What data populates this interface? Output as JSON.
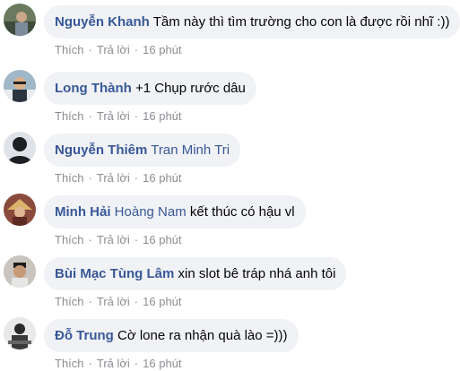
{
  "comments": [
    {
      "author": "Nguyễn Khanh",
      "tag": "",
      "text": "Tầm này thì tìm trường cho con là được rồi nhĩ :))",
      "like": "Thích",
      "reply": "Trả lời",
      "time": "16 phút"
    },
    {
      "author": "Long Thành",
      "tag": "",
      "text": "+1 Chụp rước dâu",
      "like": "Thích",
      "reply": "Trả lời",
      "time": "16 phút"
    },
    {
      "author": "Nguyễn Thiêm",
      "tag": "Tran Minh Tri",
      "text": "",
      "like": "Thích",
      "reply": "Trả lời",
      "time": "16 phút"
    },
    {
      "author": "Minh Hải",
      "tag": "Hoàng Nam",
      "text": "kết thúc có hậu vl",
      "like": "Thích",
      "reply": "Trả lời",
      "time": "16 phút"
    },
    {
      "author": "Bùi Mạc Tùng Lâm",
      "tag": "",
      "text": "xin slot bê tráp nhá anh tôi",
      "like": "Thích",
      "reply": "Trả lời",
      "time": "16 phút"
    },
    {
      "author": "Đỗ Trung",
      "tag": "",
      "text": "Cờ lone ra nhận quà lào =)))",
      "like": "Thích",
      "reply": "Trả lời",
      "time": "16 phút"
    }
  ],
  "colors": {
    "author": "#385898",
    "bubble": "#f0f2f5",
    "meta": "#8a8d91"
  },
  "icons": [
    "avatar-photo",
    "default-avatar-icon"
  ]
}
